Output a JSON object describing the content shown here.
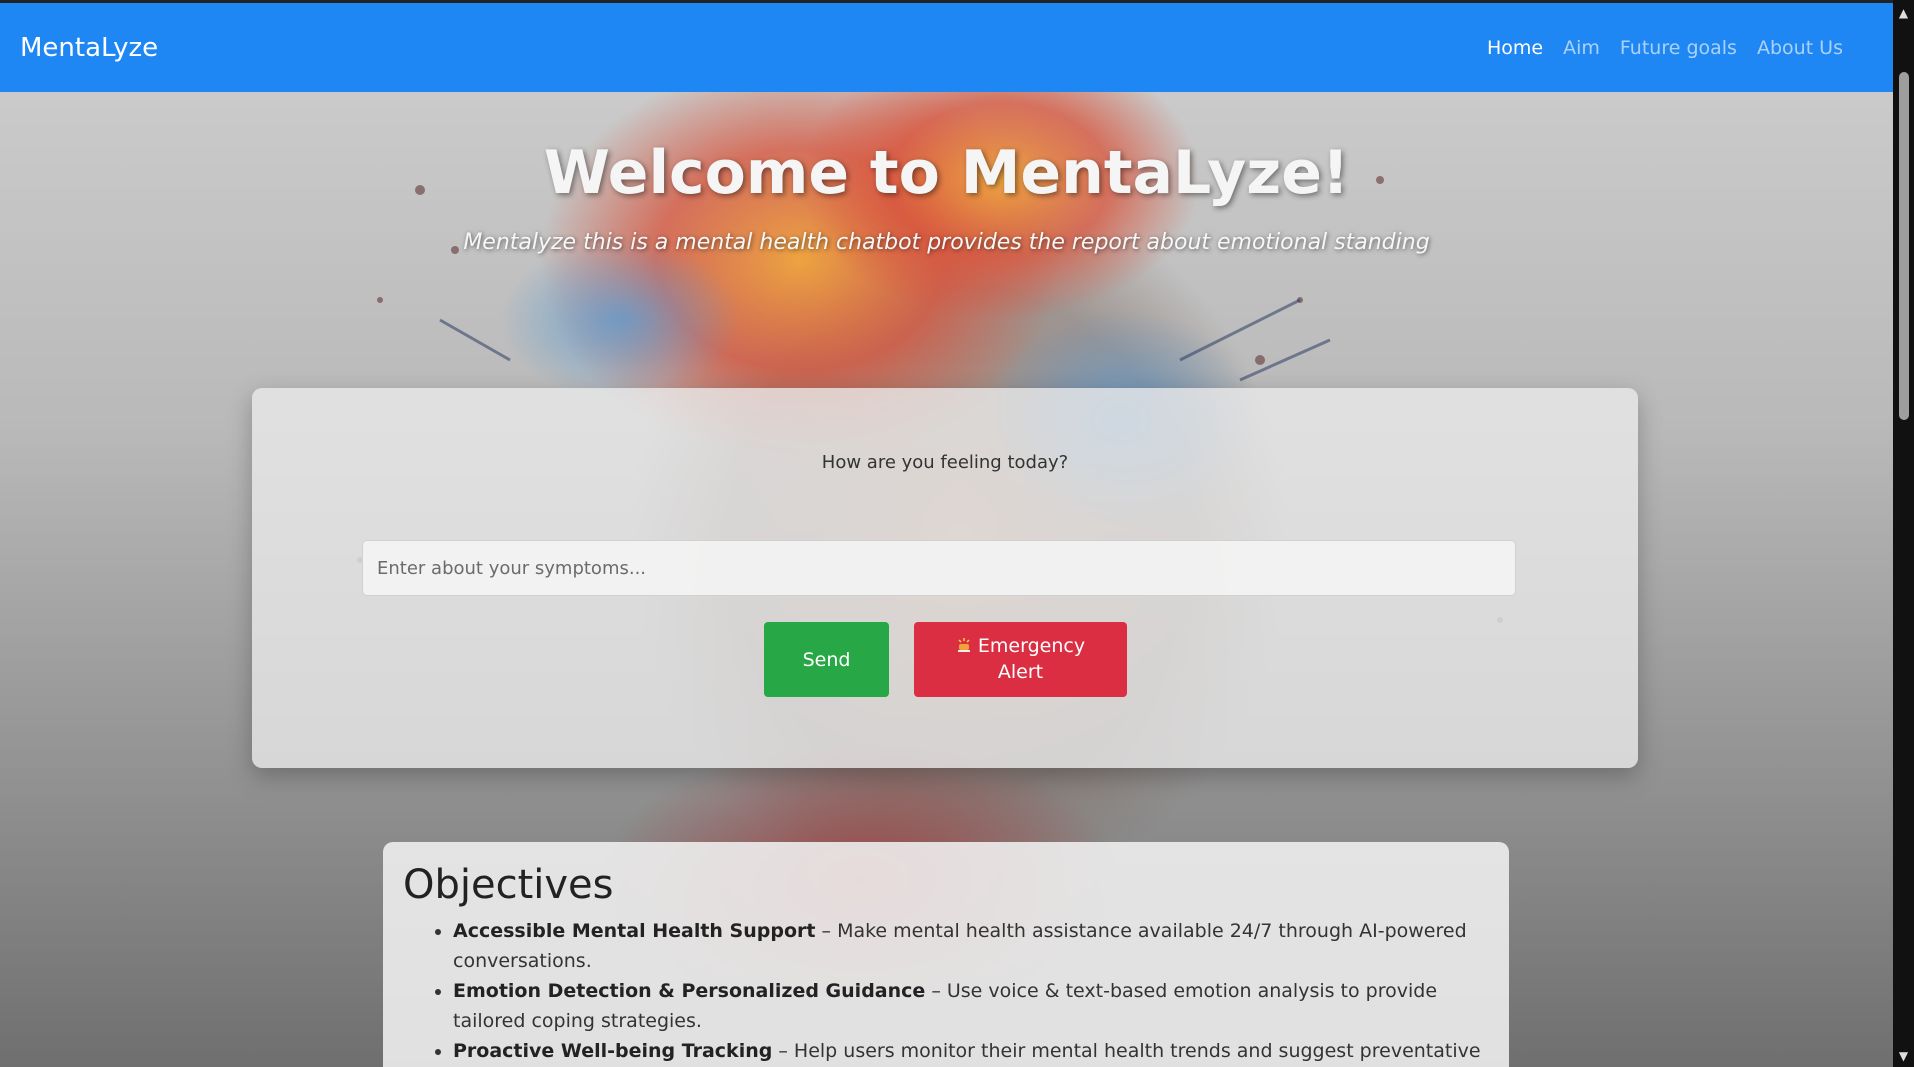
{
  "navbar": {
    "brand": "MentaLyze",
    "links": [
      {
        "label": "Home",
        "active": true
      },
      {
        "label": "Aim",
        "active": false
      },
      {
        "label": "Future goals",
        "active": false
      },
      {
        "label": "About Us",
        "active": false
      }
    ]
  },
  "hero": {
    "title": "Welcome to MentaLyze!",
    "subtitle": "Mentalyze this is a mental health chatbot provides the report about emotional standing"
  },
  "chat": {
    "question": "How are you feeling today?",
    "input_placeholder": "Enter about your symptoms...",
    "input_value": "",
    "send_label": "Send",
    "emergency_icon": "siren-icon",
    "emergency_label": "Emergency Alert"
  },
  "objectives": {
    "title": "Objectives",
    "items": [
      {
        "bold": "Accessible Mental Health Support",
        "text": " – Make mental health assistance available 24/7 through AI-powered conversations."
      },
      {
        "bold": "Emotion Detection & Personalized Guidance",
        "text": " – Use voice & text-based emotion analysis to provide tailored coping strategies."
      },
      {
        "bold": "Proactive Well-being Tracking",
        "text": " – Help users monitor their mental health trends and suggest preventative care."
      }
    ]
  },
  "colors": {
    "navbar": "#1f87f3",
    "send": "#27a745",
    "emergency": "#dc2e43"
  }
}
